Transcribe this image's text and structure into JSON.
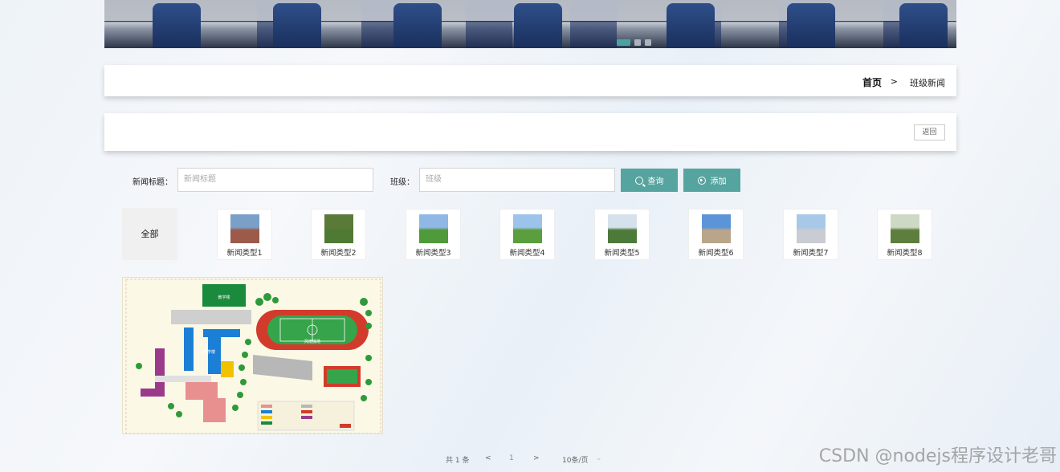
{
  "breadcrumb": {
    "home": "首页",
    "separator": ">",
    "current": "班级新闻"
  },
  "back_button": "返回",
  "search": {
    "title_label": "新闻标题：",
    "title_placeholder": "新闻标题",
    "class_label": "班级：",
    "class_placeholder": "班级",
    "query_button": "查询",
    "add_button": "添加"
  },
  "categories": {
    "all": "全部",
    "items": [
      {
        "label": "新闻类型1",
        "color_top": "#7aa0c8",
        "color_bottom": "#9b5a4a"
      },
      {
        "label": "新闻类型2",
        "color_top": "#5a7a3a",
        "color_bottom": "#4f7a33"
      },
      {
        "label": "新闻类型3",
        "color_top": "#8fb8e6",
        "color_bottom": "#4f9a3a"
      },
      {
        "label": "新闻类型4",
        "color_top": "#9cc4ea",
        "color_bottom": "#5a9e3e"
      },
      {
        "label": "新闻类型5",
        "color_top": "#d5e2ec",
        "color_bottom": "#4d7a3a"
      },
      {
        "label": "新闻类型6",
        "color_top": "#5b94d8",
        "color_bottom": "#b8a58a"
      },
      {
        "label": "新闻类型7",
        "color_top": "#a8c8e8",
        "color_bottom": "#c9ccd2"
      },
      {
        "label": "新闻类型8",
        "color_top": "#cdd9c4",
        "color_bottom": "#5e7e3e"
      }
    ]
  },
  "map_labels": {
    "building_top": "教学楼",
    "track": "风雨操场",
    "teaching": "教学楼"
  },
  "pagination": {
    "total": "共 1 条",
    "prev": "<",
    "page": "1",
    "next": ">",
    "size": "10条/页"
  },
  "watermark": "CSDN @nodejs程序设计老哥",
  "colors": {
    "accent": "#56a49f",
    "dot_active": "#4aa3a3"
  }
}
